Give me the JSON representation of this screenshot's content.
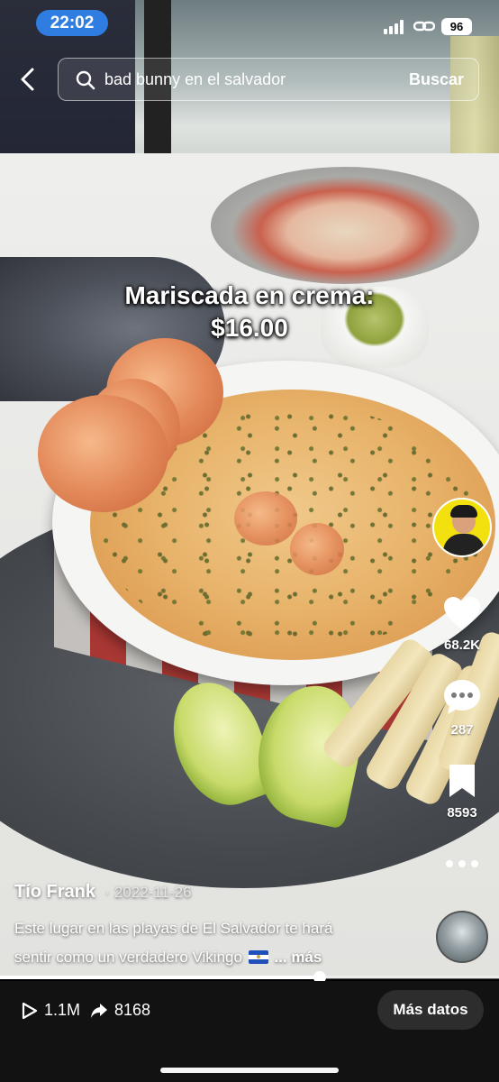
{
  "status_bar": {
    "time": "22:02",
    "battery": "96"
  },
  "search": {
    "query": "bad bunny en el salvador",
    "button_label": "Buscar"
  },
  "video": {
    "caption_line1": "Mariscada en crema:",
    "caption_line2": "$16.00",
    "playback_progress": 0.64
  },
  "side_rail": {
    "likes": "68.2K",
    "comments": "287",
    "saves": "8593"
  },
  "post": {
    "author": "Tío Frank",
    "date": "· 2022-11-26",
    "description_line1": "Este lugar en las playas de El Salvador te hará",
    "description_line2": "sentir como un verdadero Vikingo",
    "more_label": "... más"
  },
  "bottom_bar": {
    "plays": "1.1M",
    "shares": "8168",
    "more_data_label": "Más datos"
  },
  "colors": {
    "time_pill": "#2f7de1",
    "bottom_bar": "#121212",
    "avatar_bg": "#f2e10f"
  },
  "icons": [
    "back-arrow-icon",
    "search-icon",
    "heart-icon",
    "comment-icon",
    "bookmark-icon",
    "more-dots-icon",
    "play-icon",
    "share-icon"
  ]
}
